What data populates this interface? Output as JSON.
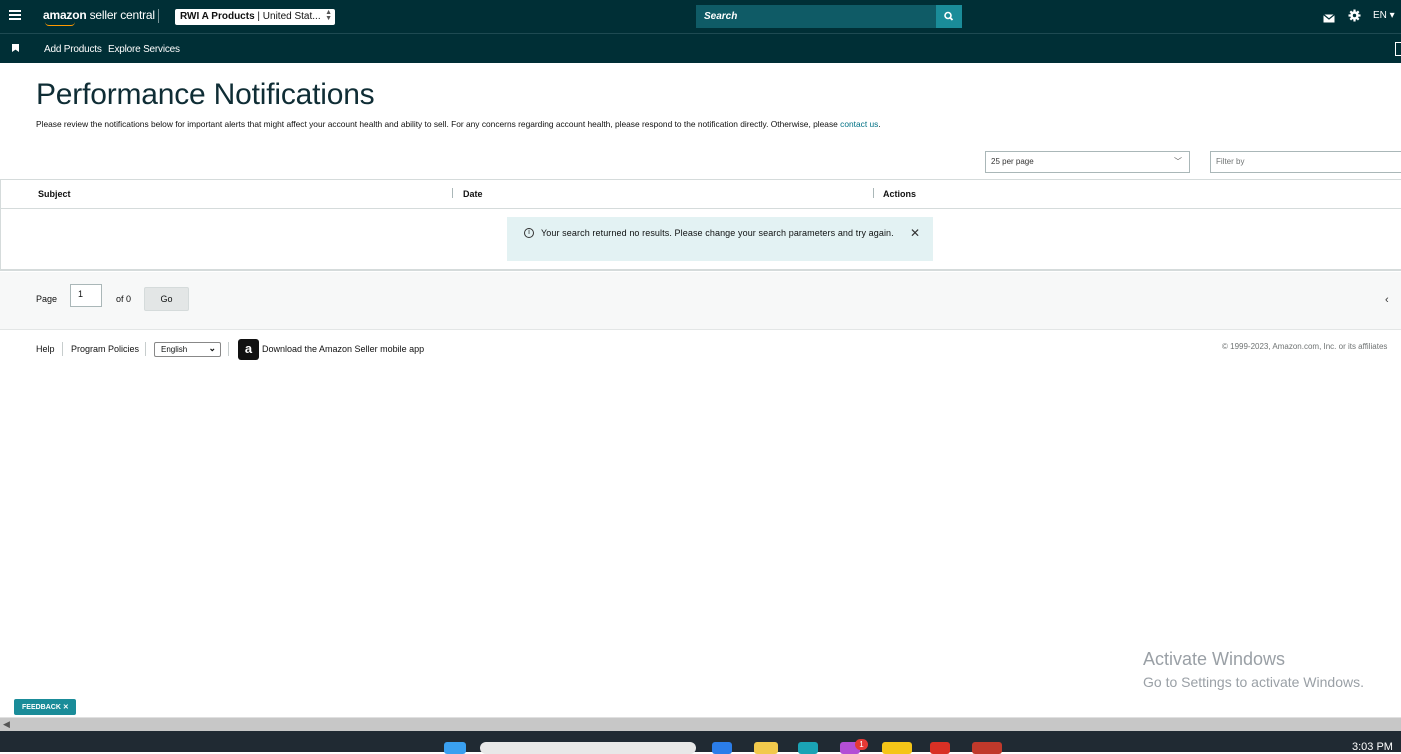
{
  "header": {
    "logo_bold": "amazon",
    "logo_rest": " seller central",
    "account_name": "RWI A Products",
    "account_region": " | United Stat...",
    "search_placeholder": "Search",
    "lang": "EN ▾"
  },
  "nav": {
    "items": [
      "Add Products",
      "Explore Services"
    ]
  },
  "page": {
    "title": "Performance Notifications",
    "description_text": "Please review the notifications below for important alerts that might affect your account health and ability to sell. For any concerns regarding account health, please respond to the notification directly. Otherwise, please ",
    "description_link": "contact us",
    "description_end": "."
  },
  "controls": {
    "per_page": "25 per page",
    "filter_placeholder": "Filter by"
  },
  "table": {
    "columns": [
      "Subject",
      "Date",
      "Actions"
    ]
  },
  "alert": {
    "message": "Your search returned no results. Please change your search parameters and try again."
  },
  "pagination": {
    "page_label": "Page",
    "page_value": "1",
    "of_label": "of 0",
    "go_label": "Go"
  },
  "footer": {
    "help": "Help",
    "policies": "Program Policies",
    "language": "English",
    "app_link": "Download the Amazon Seller mobile app",
    "copyright": "© 1999-2023, Amazon.com, Inc. or its affiliates"
  },
  "overlay": {
    "activate_title": "Activate Windows",
    "activate_sub": "Go to Settings to activate Windows.",
    "feedback": "FEEDBACK"
  },
  "taskbar": {
    "time": "3:03 PM",
    "badge": "1"
  },
  "colors": {
    "header_bg": "#002f36",
    "accent": "#1a8c99",
    "link": "#007185"
  }
}
